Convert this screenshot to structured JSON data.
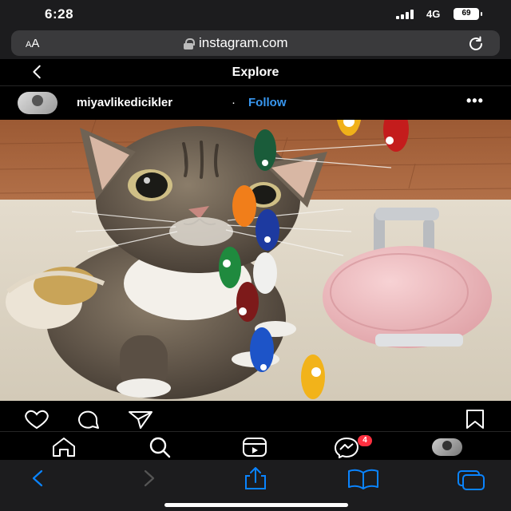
{
  "status": {
    "time": "6:28",
    "network": "4G",
    "battery": "69"
  },
  "browser": {
    "text_size_label": "A",
    "text_size_label_large": "A",
    "url": "instagram.com"
  },
  "header": {
    "title": "Explore"
  },
  "post": {
    "username": "miyavlikedicikler",
    "separator": "·",
    "follow_label": "Follow",
    "more_label": "•••"
  },
  "nav": {
    "activity_badge": "4"
  },
  "icons": {
    "back": "chevron-left-icon",
    "reload": "reload-icon",
    "like": "heart-icon",
    "comment": "comment-icon",
    "share": "paper-plane-icon",
    "save": "bookmark-icon",
    "home": "home-icon",
    "search": "search-icon",
    "reels": "reels-icon",
    "messages": "messenger-icon",
    "safari_back": "chevron-left-icon",
    "safari_forward": "chevron-right-icon",
    "safari_share": "share-icon",
    "safari_bookmarks": "book-icon",
    "safari_tabs": "tabs-icon"
  },
  "colors": {
    "accent": "#3897f0",
    "badge": "#ff3040",
    "safari_tint": "#0a84ff"
  }
}
